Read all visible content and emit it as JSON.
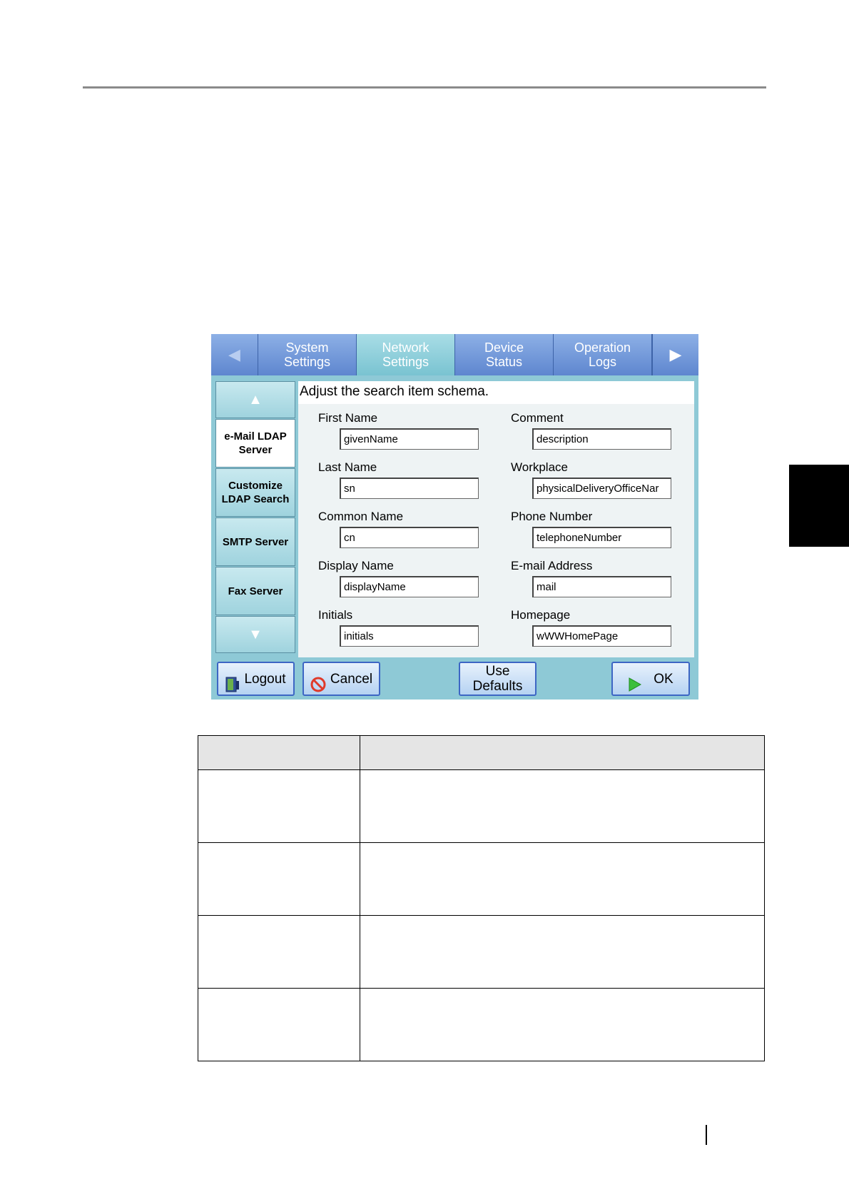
{
  "tabs": {
    "items": [
      {
        "label": "System\nSettings",
        "active": false
      },
      {
        "label": "Network\nSettings",
        "active": true
      },
      {
        "label": "Device\nStatus",
        "active": false
      },
      {
        "label": "Operation\nLogs",
        "active": false
      }
    ],
    "left_arrow": "◀",
    "right_arrow": "▶"
  },
  "nav": {
    "up_arrow": "▲",
    "down_arrow": "▼",
    "items": [
      {
        "label": "e-Mail LDAP\nServer",
        "selected": true
      },
      {
        "label": "Customize\nLDAP Search",
        "selected": false
      },
      {
        "label": "SMTP Server",
        "selected": false
      },
      {
        "label": "Fax Server",
        "selected": false
      }
    ]
  },
  "content": {
    "title": "Adjust the search item schema.",
    "fields": [
      {
        "label": "First Name",
        "value": "givenName"
      },
      {
        "label": "Comment",
        "value": "description"
      },
      {
        "label": "Last Name",
        "value": "sn"
      },
      {
        "label": "Workplace",
        "value": "physicalDeliveryOfficeNar"
      },
      {
        "label": "Common Name",
        "value": "cn"
      },
      {
        "label": "Phone Number",
        "value": "telephoneNumber"
      },
      {
        "label": "Display Name",
        "value": "displayName"
      },
      {
        "label": "E-mail Address",
        "value": "mail"
      },
      {
        "label": "Initials",
        "value": "initials"
      },
      {
        "label": "Homepage",
        "value": "wWWHomePage"
      }
    ]
  },
  "buttons": {
    "logout": "Logout",
    "cancel": "Cancel",
    "use_defaults": "Use\nDefaults",
    "ok": "OK"
  },
  "colors": {
    "tabbar": "#5e86cf",
    "panel": "#8ec9d6",
    "button_border": "#3d66c4",
    "page_side_tab": "#000000"
  }
}
